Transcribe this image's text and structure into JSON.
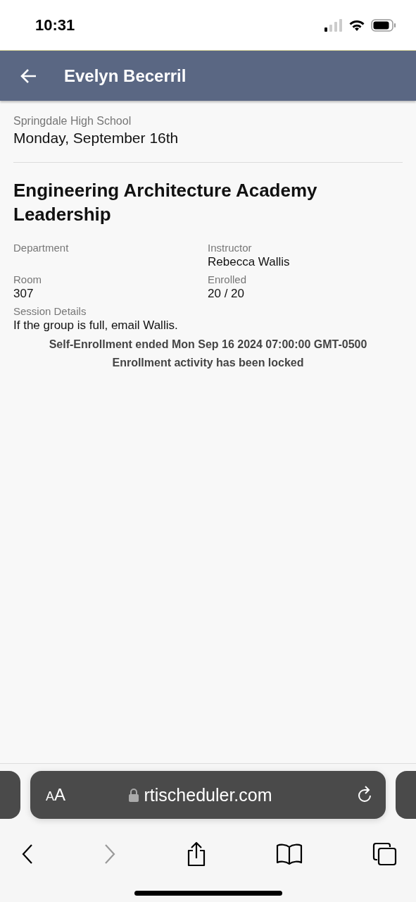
{
  "status_bar": {
    "time": "10:31"
  },
  "header": {
    "title": "Evelyn Becerril"
  },
  "school": "Springdale High School",
  "date": "Monday, September 16th",
  "session": {
    "title": "Engineering Architecture Academy Leadership",
    "fields": [
      {
        "label": "Department"
      },
      {
        "label": "Instructor",
        "value": "Rebecca Wallis"
      },
      {
        "label": "Room",
        "value": "307"
      },
      {
        "label": "Enrolled",
        "value": "20 / 20"
      }
    ],
    "details": {
      "label": "Session Details",
      "value": "If the group is full, email Wallis."
    },
    "notices": [
      "Self-Enrollment ended Mon Sep 16 2024 07:00:00 GMT-0500",
      "Enrollment activity has been locked"
    ]
  },
  "browser": {
    "text_size": "AA",
    "url": "rtischeduler.com",
    "back_disabled": false,
    "forward_disabled": true
  }
}
